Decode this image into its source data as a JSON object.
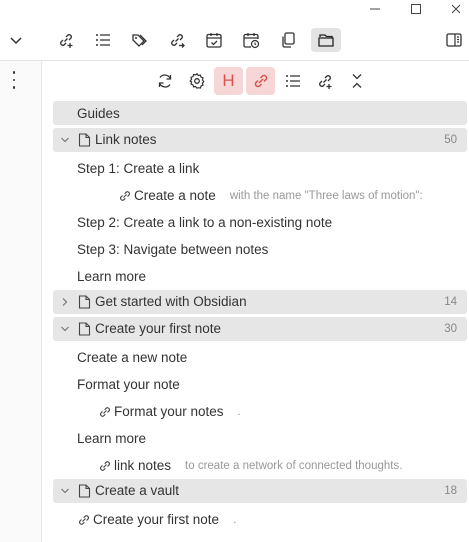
{
  "window_controls": {
    "minimize": "–",
    "maximize": "□",
    "close": "✕"
  },
  "toolbar": {
    "icons": [
      "chevron-down-icon",
      "link-add-icon",
      "bullet-list-icon",
      "tags-icon",
      "link-forward-icon",
      "calendar-check-icon",
      "calendar-clock-icon",
      "copy-icon",
      "folder-open-icon",
      "sidebar-toggle-icon"
    ],
    "active_icon": "folder-open-icon"
  },
  "pane_tools": {
    "icons": [
      "refresh-icon",
      "gear-icon",
      "heading-icon",
      "link-icon",
      "list-icon",
      "link-add-icon",
      "collapse-icon"
    ],
    "heading_letter": "H",
    "highlight_color": "#f6d6d6"
  },
  "tree": {
    "guides_label": "Guides",
    "groups": [
      {
        "label": "Link notes",
        "count": "50",
        "expanded": true,
        "items": [
          {
            "text": "Step 1: Create a link"
          },
          {
            "text": "Create a note",
            "link": true,
            "context": "with the name \"Three laws of motion\":"
          },
          {
            "text": "Step 2: Create a link to a non-existing note"
          },
          {
            "text": "Step 3: Navigate between notes"
          },
          {
            "text": "Learn more"
          }
        ]
      },
      {
        "label": "Get started with Obsidian",
        "count": "14",
        "expanded": false,
        "items": []
      },
      {
        "label": "Create your first note",
        "count": "30",
        "expanded": true,
        "items": [
          {
            "text": "Create a new note"
          },
          {
            "text": "Format your note"
          },
          {
            "text": "Format your notes",
            "link": true,
            "context": "."
          },
          {
            "text": "Learn more"
          },
          {
            "text": "link notes",
            "link": true,
            "context": "to create a network of connected thoughts."
          }
        ]
      },
      {
        "label": "Create a vault",
        "count": "18",
        "expanded": true,
        "items": [
          {
            "text": "Create your first note",
            "link": true,
            "context": "."
          }
        ]
      }
    ]
  }
}
